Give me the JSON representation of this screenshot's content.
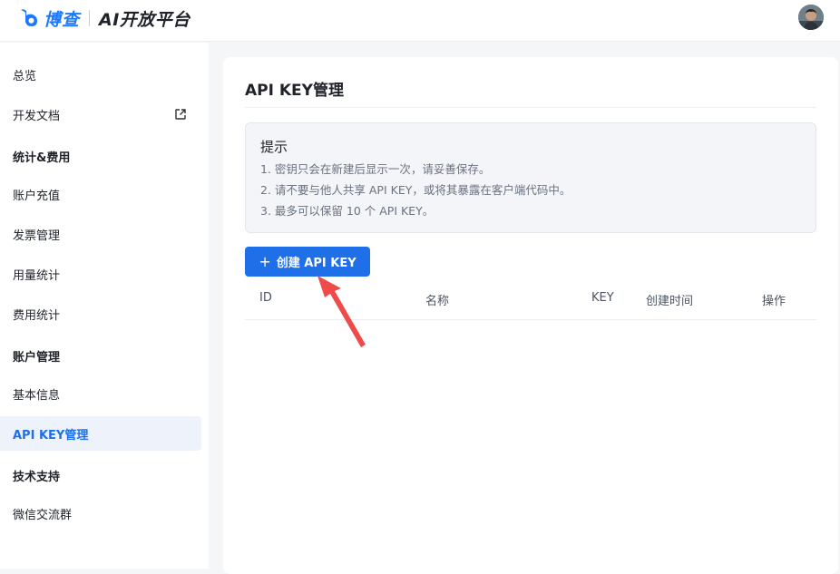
{
  "header": {
    "brand": "博查",
    "product": "AI开放平台"
  },
  "sidebar": {
    "items": [
      {
        "label": "总览",
        "kind": "item"
      },
      {
        "label": "开发文档",
        "kind": "item",
        "external": true
      },
      {
        "label": "统计&费用",
        "kind": "group"
      },
      {
        "label": "账户充值",
        "kind": "item"
      },
      {
        "label": "发票管理",
        "kind": "item"
      },
      {
        "label": "用量统计",
        "kind": "item"
      },
      {
        "label": "费用统计",
        "kind": "item"
      },
      {
        "label": "账户管理",
        "kind": "group"
      },
      {
        "label": "基本信息",
        "kind": "item"
      },
      {
        "label": "API KEY管理",
        "kind": "item",
        "active": true
      },
      {
        "label": "技术支持",
        "kind": "group"
      },
      {
        "label": "微信交流群",
        "kind": "item"
      }
    ]
  },
  "main": {
    "title": "API KEY管理",
    "tip": {
      "title": "提示",
      "lines": [
        "1. 密钥只会在新建后显示一次，请妥善保存。",
        "2. 请不要与他人共享 API KEY，或将其暴露在客户端代码中。",
        "3. 最多可以保留 10 个 API KEY。"
      ]
    },
    "create_button": "创建 API KEY",
    "table": {
      "columns": [
        "ID",
        "名称",
        "KEY",
        "创建时间",
        "操作"
      ]
    }
  },
  "colors": {
    "accent": "#1e6fe8",
    "brand": "#1e78ff",
    "annotation_arrow": "#ef4b4b"
  },
  "icons": {
    "external_link": "external-link-icon",
    "plus": "plus-icon"
  }
}
